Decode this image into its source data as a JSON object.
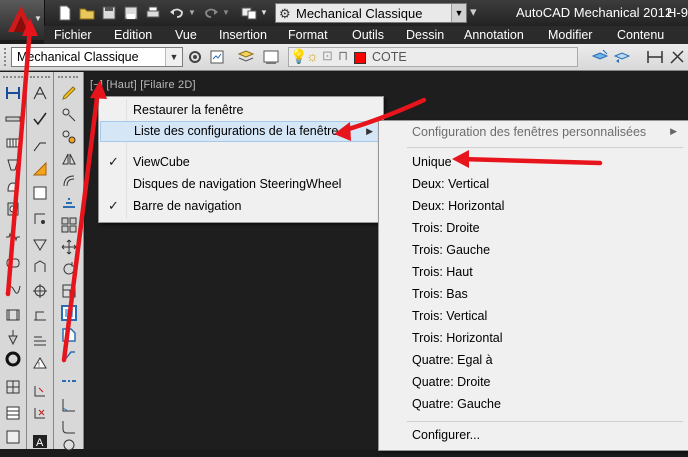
{
  "title_bar": {
    "workspace": "Mechanical Classique",
    "app_title": "AutoCAD Mechanical 2012",
    "build_fragment": "H-9"
  },
  "menu_bar": {
    "items": [
      "Fichier",
      "Edition",
      "Vue",
      "Insertion",
      "Format",
      "Outils",
      "Dessin",
      "Annotation",
      "Modifier",
      "Contenu"
    ]
  },
  "toolbar": {
    "workspace_dropdown": "Mechanical Classique",
    "layer_name": "COTE",
    "layer_color": "#ff0000"
  },
  "viewport": {
    "label": "[−] [Haut] [Filaire 2D]"
  },
  "context_menu": {
    "items": [
      {
        "label": "Restaurer la fenêtre",
        "checked": false,
        "submenu": false
      },
      {
        "label": "Liste des configurations de la fenêtre",
        "checked": false,
        "submenu": true
      },
      {
        "label": "ViewCube",
        "checked": true,
        "submenu": false
      },
      {
        "label": "Disques de navigation SteeringWheel",
        "checked": false,
        "submenu": false
      },
      {
        "label": "Barre de navigation",
        "checked": true,
        "submenu": false
      }
    ]
  },
  "submenu": {
    "header": "Configuration des fenêtres personnalisées",
    "items": [
      "Unique",
      "Deux: Vertical",
      "Deux: Horizontal",
      "Trois: Droite",
      "Trois: Gauche",
      "Trois: Haut",
      "Trois: Bas",
      "Trois: Vertical",
      "Trois: Horizontal",
      "Quatre: Egal à",
      "Quatre: Droite",
      "Quatre: Gauche"
    ],
    "footer": "Configurer..."
  },
  "colors": {
    "annotation_arrow": "#e8141c",
    "highlight": "#d5e6f7",
    "menu_bg": "#f0f0f0"
  },
  "icons": {
    "check": "✓",
    "submenu_arrow": "▶"
  }
}
